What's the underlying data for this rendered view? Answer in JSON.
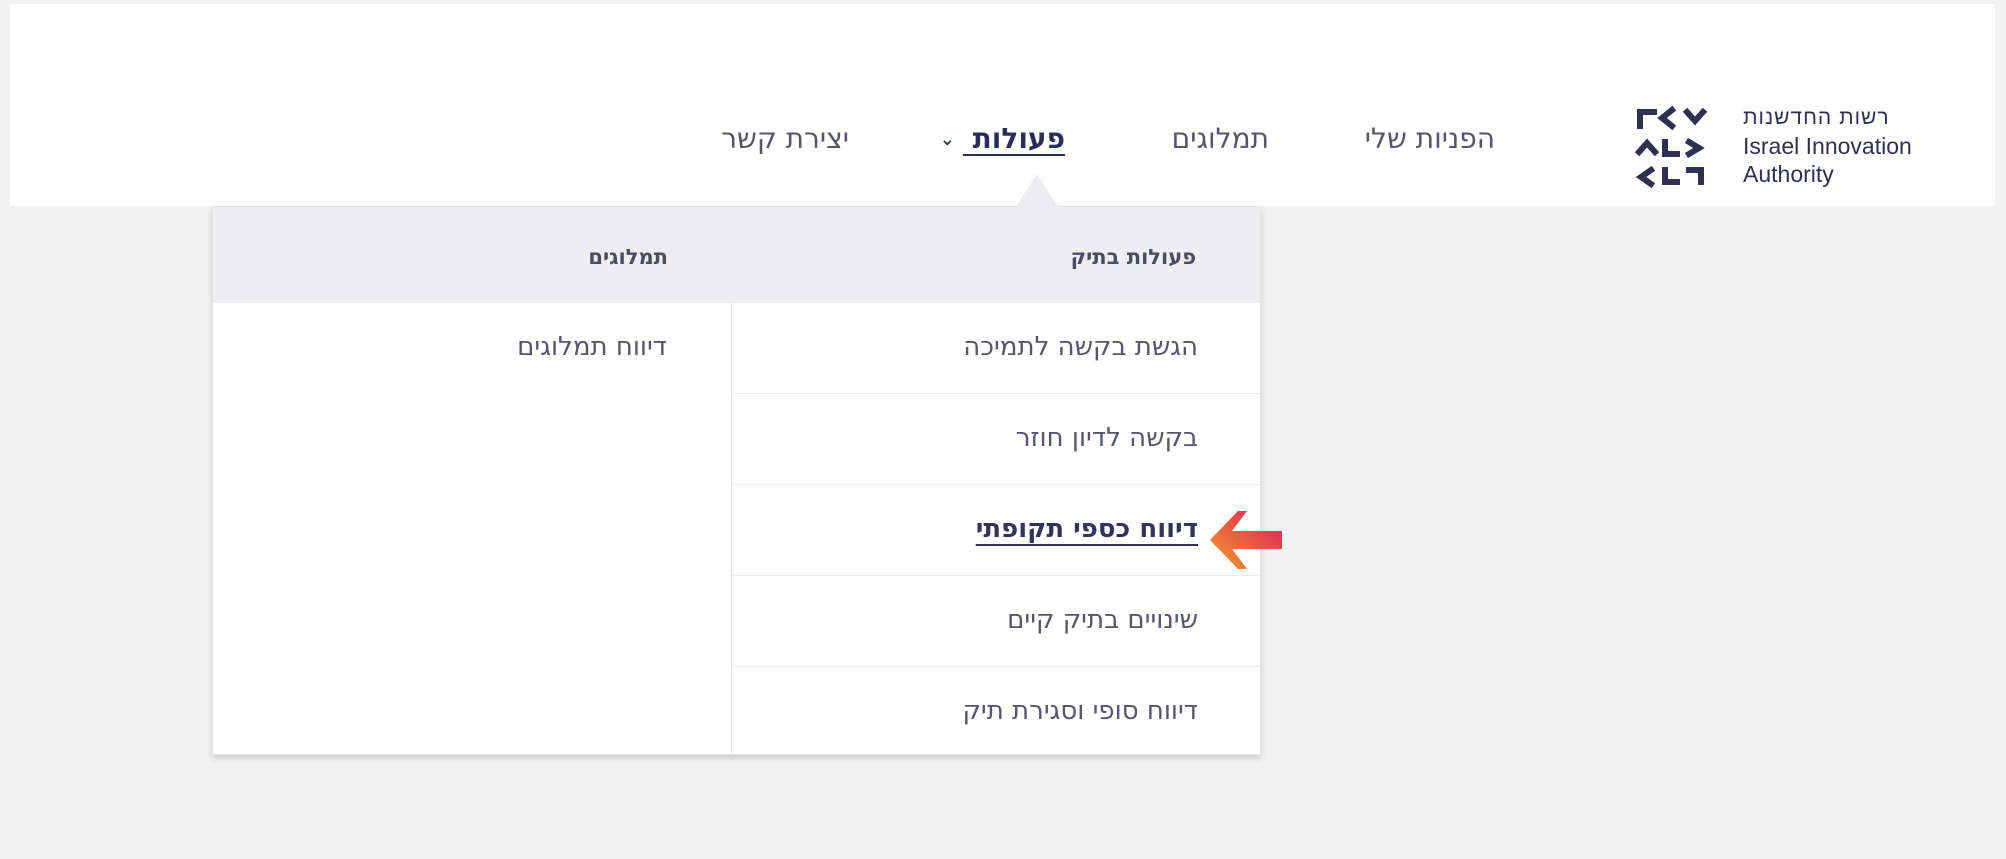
{
  "brand": {
    "hebrew_name": "רשות החדשנות",
    "english_line_1": "Israel Innovation",
    "english_line_2": "Authority"
  },
  "nav": {
    "items": [
      {
        "label": "הפניות שלי"
      },
      {
        "label": "תמלוגים"
      },
      {
        "label": "פעולות",
        "chevron": "⌄"
      },
      {
        "label": "יצירת קשר"
      }
    ]
  },
  "dropdown": {
    "columns": [
      {
        "title": "פעולות בתיק",
        "items": [
          {
            "label": "הגשת בקשה לתמיכה"
          },
          {
            "label": "בקשה לדיון חוזר"
          },
          {
            "label": "דיווח כספי תקופתי"
          },
          {
            "label": "שינויים בתיק קיים"
          },
          {
            "label": "דיווח סופי וסגירת תיק"
          }
        ]
      },
      {
        "title": "תמלוגים",
        "items": [
          {
            "label": "דיווח תמלוגים"
          }
        ]
      }
    ]
  },
  "colors": {
    "navy": "#2f2f52",
    "arrow_magenta": "#d91b5c",
    "arrow_orange": "#f59d2a"
  }
}
